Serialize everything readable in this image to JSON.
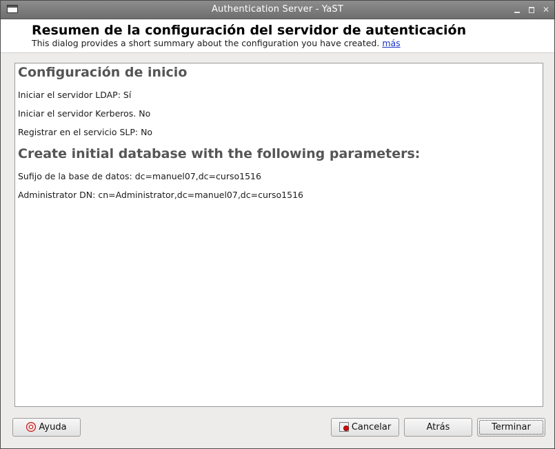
{
  "window": {
    "title": "Authentication Server - YaST"
  },
  "header": {
    "title": "Resumen de la configuración del servidor de autenticación",
    "subtitle": "This dialog provides a short summary about the configuration you have created.",
    "more_link": "más"
  },
  "summary": {
    "section1_title": "Configuración de inicio",
    "items1": [
      "Iniciar el servidor LDAP: Sí",
      "Iniciar el servidor Kerberos. No",
      "Registrar en el servicio SLP: No"
    ],
    "section2_title": "Create initial database with the following parameters:",
    "items2": [
      "Sufijo de la base de datos: dc=manuel07,dc=curso1516",
      "Administrator DN: cn=Administrator,dc=manuel07,dc=curso1516"
    ]
  },
  "buttons": {
    "help": "Ayuda",
    "cancel": "Cancelar",
    "back": "Atrás",
    "finish": "Terminar"
  }
}
